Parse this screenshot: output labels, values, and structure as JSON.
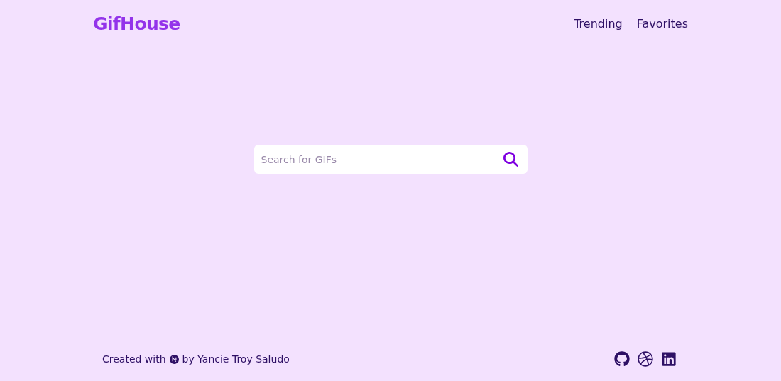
{
  "header": {
    "logo": "GifHouse",
    "nav": [
      {
        "label": "Trending"
      },
      {
        "label": "Favorites"
      }
    ]
  },
  "search": {
    "placeholder": "Search for GIFs"
  },
  "footer": {
    "prefix": "Created with",
    "suffix": "by Yancie Troy Saludo"
  }
}
